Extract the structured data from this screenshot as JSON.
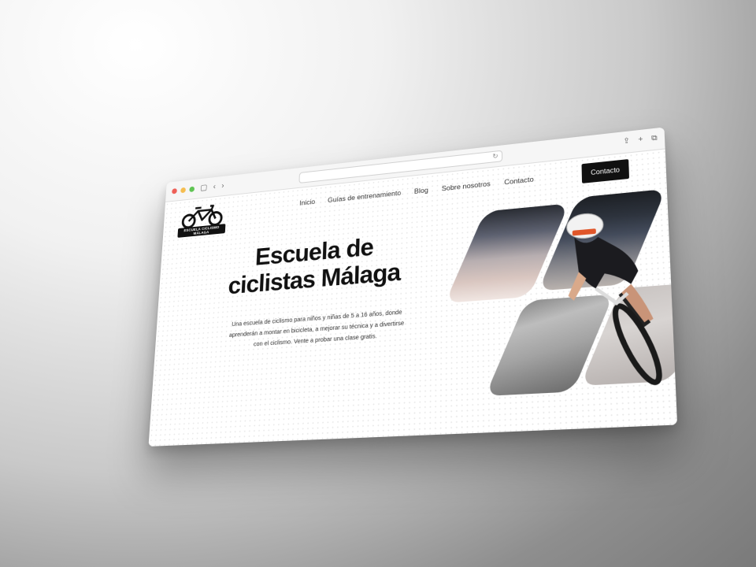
{
  "browser": {
    "icons": [
      "sidebar-icon",
      "back-icon",
      "forward-icon",
      "reload-icon",
      "share-icon",
      "new-tab-icon",
      "tabs-overview-icon"
    ],
    "glyphs": {
      "sidebar": "▢",
      "back": "‹",
      "forward": "›",
      "reload": "↻",
      "share": "⇪",
      "new_tab": "+",
      "tabs": "⧉"
    }
  },
  "site": {
    "logo_text": "ESCUELA CICLISMO MÁLAGA",
    "nav": [
      "Inicio",
      "Guías de entrenamiento",
      "Blog",
      "Sobre nosotros",
      "Contacto"
    ],
    "cta_label": "Contacto"
  },
  "hero": {
    "title_line1": "Escuela de",
    "title_line2": "ciclistas Málaga",
    "description": "Una escuela de ciclismo para niños y niñas de 5 a 16 años, donde aprenderán a montar en bicicleta, a mejorar su técnica y a divertirse con el ciclismo. Vente a probar una clase gratis."
  },
  "colors": {
    "accent": "#111111",
    "background": "#ffffff",
    "text": "#333333"
  }
}
